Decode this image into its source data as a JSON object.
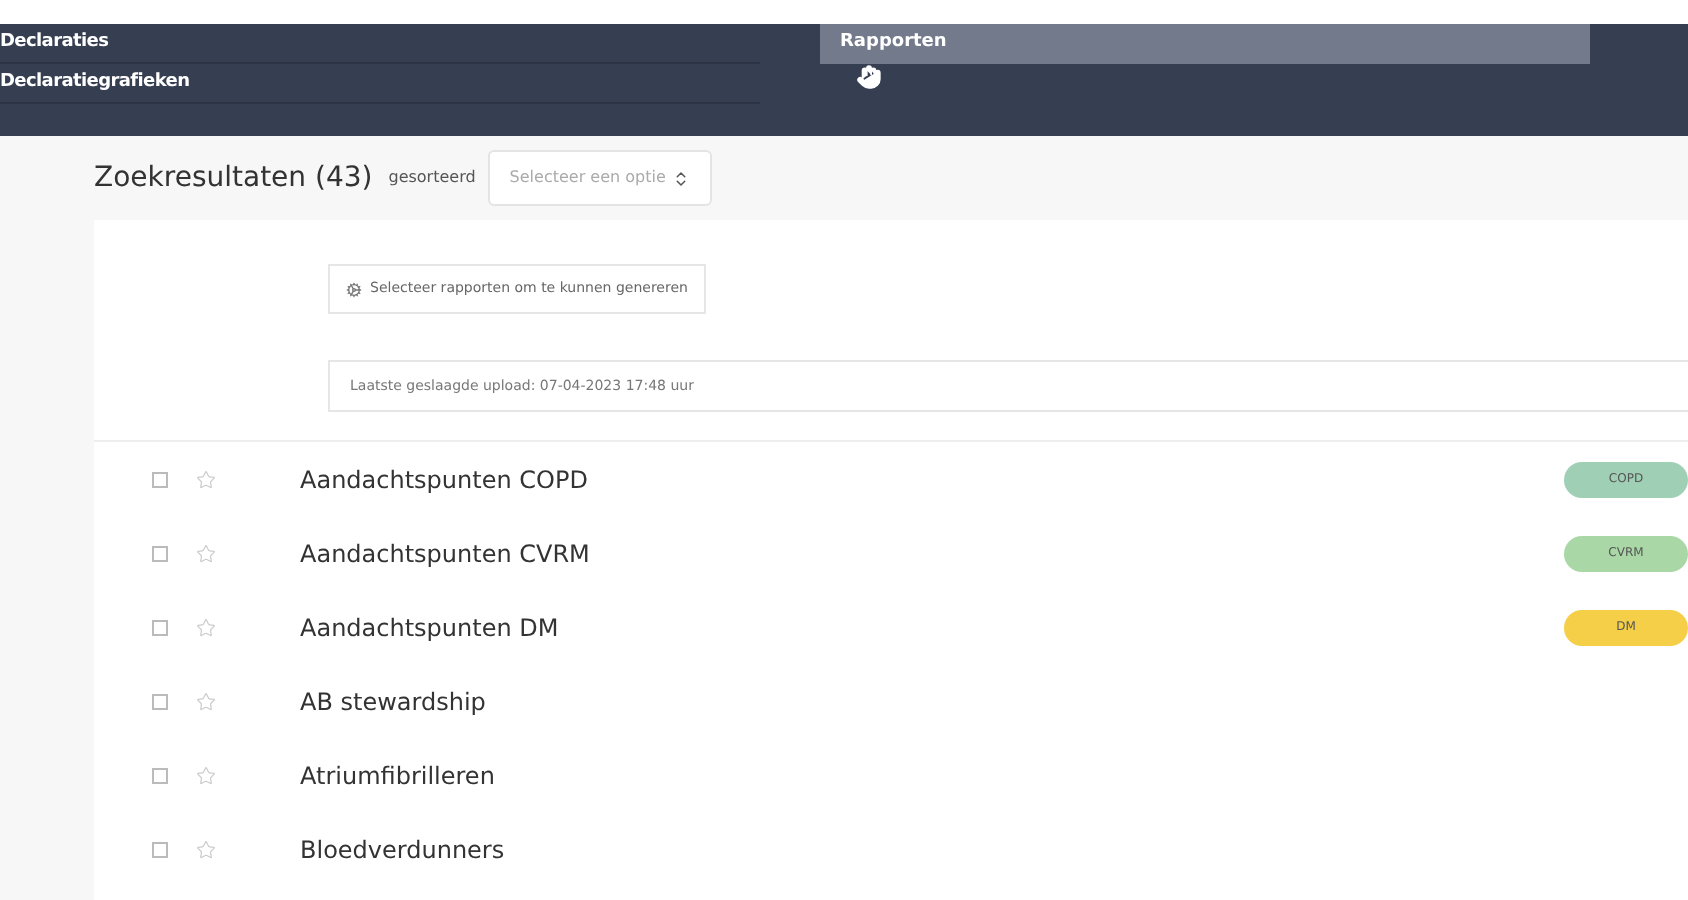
{
  "nav": {
    "items": [
      {
        "label": "Declaraties",
        "selected": false
      },
      {
        "label": "Declaratiegrafieken",
        "selected": false
      }
    ],
    "submenu": [
      {
        "label": "Rapporten",
        "selected": true
      }
    ]
  },
  "results": {
    "title": "Zoekresultaten (43)",
    "sort_label": "gesorteerd",
    "sort": {
      "placeholder": "Selecteer een optie"
    }
  },
  "generate_button": "Selecteer rapporten om te kunnen genereren",
  "upload_info": "Laatste geslaagde upload: 07-04-2023 17:48 uur",
  "reports": [
    {
      "name": "Aandachtspunten COPD",
      "checked": false,
      "starred": false,
      "tag": {
        "label": "COPD",
        "color": "#9fcfb5"
      }
    },
    {
      "name": "Aandachtspunten CVRM",
      "checked": false,
      "starred": false,
      "tag": {
        "label": "CVRM",
        "color": "#a9d8a6"
      }
    },
    {
      "name": "Aandachtspunten DM",
      "checked": false,
      "starred": false,
      "tag": {
        "label": "DM",
        "color": "#f5cf47"
      }
    },
    {
      "name": "AB stewardship",
      "checked": false,
      "starred": false
    },
    {
      "name": "Atriumfibrilleren",
      "checked": false,
      "starred": false
    },
    {
      "name": "Bloedverdunners",
      "checked": false,
      "starred": false
    }
  ]
}
